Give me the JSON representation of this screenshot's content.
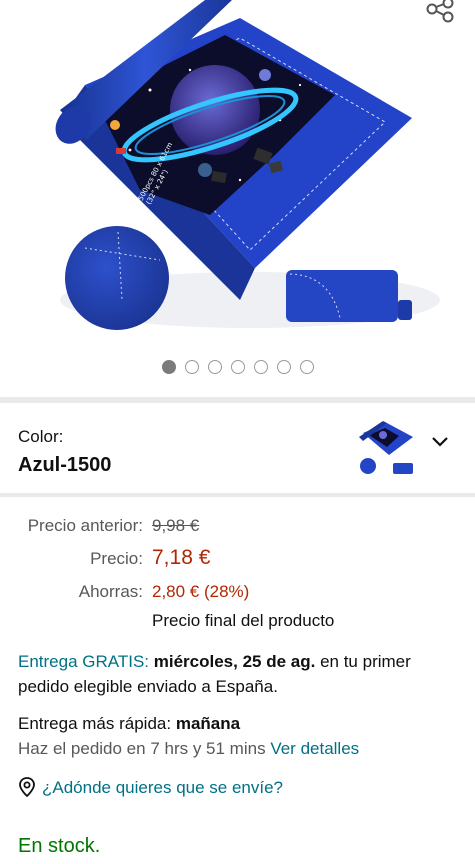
{
  "gallery": {
    "image_alt": "Tapete de puzzle azul enrollable con puzzle del espacio",
    "dots_count": 7,
    "active_dot": 0
  },
  "color": {
    "label": "Color:",
    "value": "Azul-1500"
  },
  "pricing": {
    "previous_label": "Precio anterior:",
    "previous_value": "9,98 €",
    "price_label": "Precio:",
    "price_value": "7,18 €",
    "savings_label": "Ahorras:",
    "savings_value": "2,80 € (28%)",
    "final_note": "Precio final del producto"
  },
  "delivery": {
    "free_label": "Entrega GRATIS:",
    "free_date": "miércoles, 25 de ag.",
    "free_suffix": "en tu primer pedido elegible enviado a España.",
    "fast_label": "Entrega más rápida:",
    "fast_date": "mañana",
    "order_within": "Haz el pedido en 7 hrs y 51 mins",
    "details_link": "Ver detalles"
  },
  "location_link": "¿Adónde quieres que se envíe?",
  "stock": "En stock.",
  "colors": {
    "accent_teal": "#007185",
    "price_red": "#b12704",
    "stock_green": "#007600",
    "mat_blue": "#1f3fbf"
  }
}
